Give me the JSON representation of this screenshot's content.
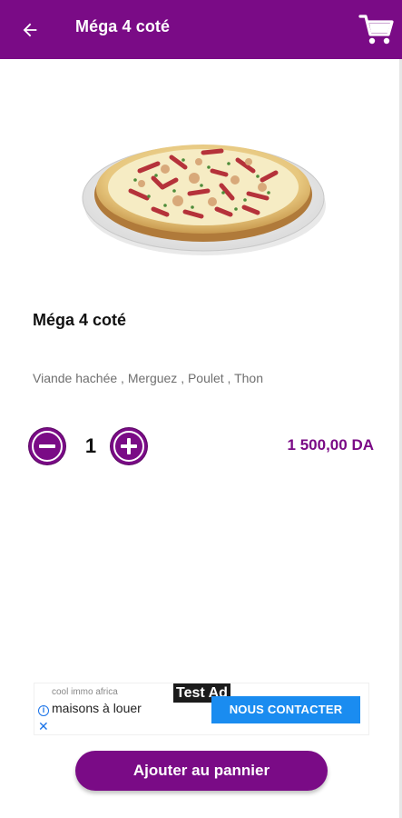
{
  "colors": {
    "brand": "#7a0b86",
    "price": "#7a0b86",
    "ad_cta": "#1a8cf0"
  },
  "header": {
    "title": "Méga 4 coté",
    "back_icon": "arrow-left-icon",
    "cart_icon": "shopping-cart-icon"
  },
  "product": {
    "image": "pizza-image",
    "name": "Méga 4 coté",
    "ingredients": "Viande hachée , Merguez , Poulet , Thon",
    "quantity": "1",
    "price": "1 500,00 DA",
    "decrease_icon": "minus-circle-icon",
    "increase_icon": "plus-circle-icon"
  },
  "ad": {
    "label": "Test Ad",
    "brand": "cool immo africa",
    "headline": "maisons à louer",
    "cta": "NOUS CONTACTER",
    "info_icon": "info-icon",
    "close_icon": "close-icon"
  },
  "footer": {
    "add_to_cart_label": "Ajouter au pannier"
  }
}
